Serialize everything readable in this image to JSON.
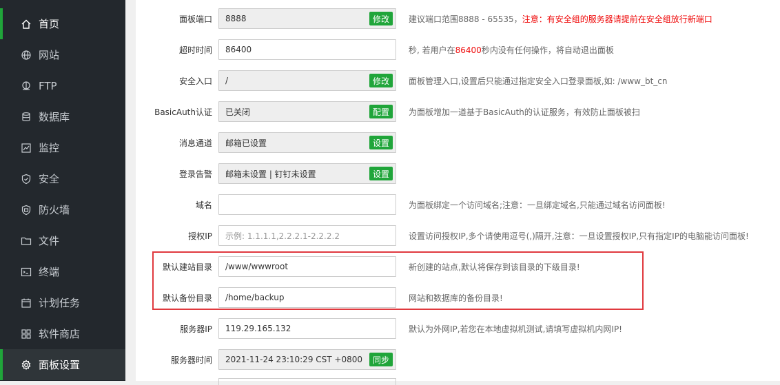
{
  "sidebar": {
    "items": [
      {
        "label": "首页",
        "icon": "home-icon"
      },
      {
        "label": "网站",
        "icon": "globe-icon"
      },
      {
        "label": "FTP",
        "icon": "ftp-icon"
      },
      {
        "label": "数据库",
        "icon": "database-icon"
      },
      {
        "label": "监控",
        "icon": "monitor-icon"
      },
      {
        "label": "安全",
        "icon": "shield-icon"
      },
      {
        "label": "防火墙",
        "icon": "firewall-icon"
      },
      {
        "label": "文件",
        "icon": "folder-icon"
      },
      {
        "label": "终端",
        "icon": "terminal-icon"
      },
      {
        "label": "计划任务",
        "icon": "calendar-icon"
      },
      {
        "label": "软件商店",
        "icon": "apps-icon"
      },
      {
        "label": "面板设置",
        "icon": "gear-icon"
      }
    ],
    "active_index": 11
  },
  "settings": {
    "panel_port": {
      "label": "面板端口",
      "value": "8888",
      "button": "修改",
      "hint": "建议端口范围8888 - 65535，",
      "warning": "注意：有安全组的服务器请提前在安全组放行新端口"
    },
    "timeout": {
      "label": "超时时间",
      "value": "86400",
      "hint_pre": "秒, 若用户在",
      "hint_value": "86400",
      "hint_post": "秒内没有任何操作，将自动退出面板"
    },
    "security_entry": {
      "label": "安全入口",
      "value": "/",
      "button": "修改",
      "hint": "面板管理入口,设置后只能通过指定安全入口登录面板,如: /www_bt_cn"
    },
    "basic_auth": {
      "label": "BasicAuth认证",
      "value": "已关闭",
      "button": "配置",
      "hint": "为面板增加一道基于BasicAuth的认证服务，有效防止面板被扫"
    },
    "message_channel": {
      "label": "消息通道",
      "value": "邮箱已设置",
      "button": "设置"
    },
    "login_alert": {
      "label": "登录告警",
      "value": "邮箱未设置 | 钉钉未设置",
      "button": "设置"
    },
    "domain": {
      "label": "域名",
      "value": "",
      "hint": "为面板绑定一个访问域名;注意：一旦绑定域名,只能通过域名访问面板!"
    },
    "auth_ip": {
      "label": "授权IP",
      "placeholder": "示例: 1.1.1.1,2.2.2.1-2.2.2.2",
      "hint": "设置访问授权IP,多个请使用逗号(,)隔开,注意：一旦设置授权IP,只有指定IP的电脑能访问面板!"
    },
    "default_site_dir": {
      "label": "默认建站目录",
      "value": "/www/wwwroot",
      "hint": "新创建的站点,默认将保存到该目录的下级目录!"
    },
    "default_backup_dir": {
      "label": "默认备份目录",
      "value": "/home/backup",
      "hint": "网站和数据库的备份目录!"
    },
    "server_ip": {
      "label": "服务器IP",
      "value": "119.29.165.132",
      "hint": "默认为外网IP,若您在本地虚拟机测试,请填写虚拟机内网IP!"
    },
    "server_time": {
      "label": "服务器时间",
      "value": "2021-11-24 23:10:29 CST +0800",
      "button": "同步"
    }
  },
  "colors": {
    "sidebar_bg": "#23282d",
    "accent_green": "#20a53a",
    "warning_red": "#ef0808",
    "highlight_red": "#e0393e"
  }
}
